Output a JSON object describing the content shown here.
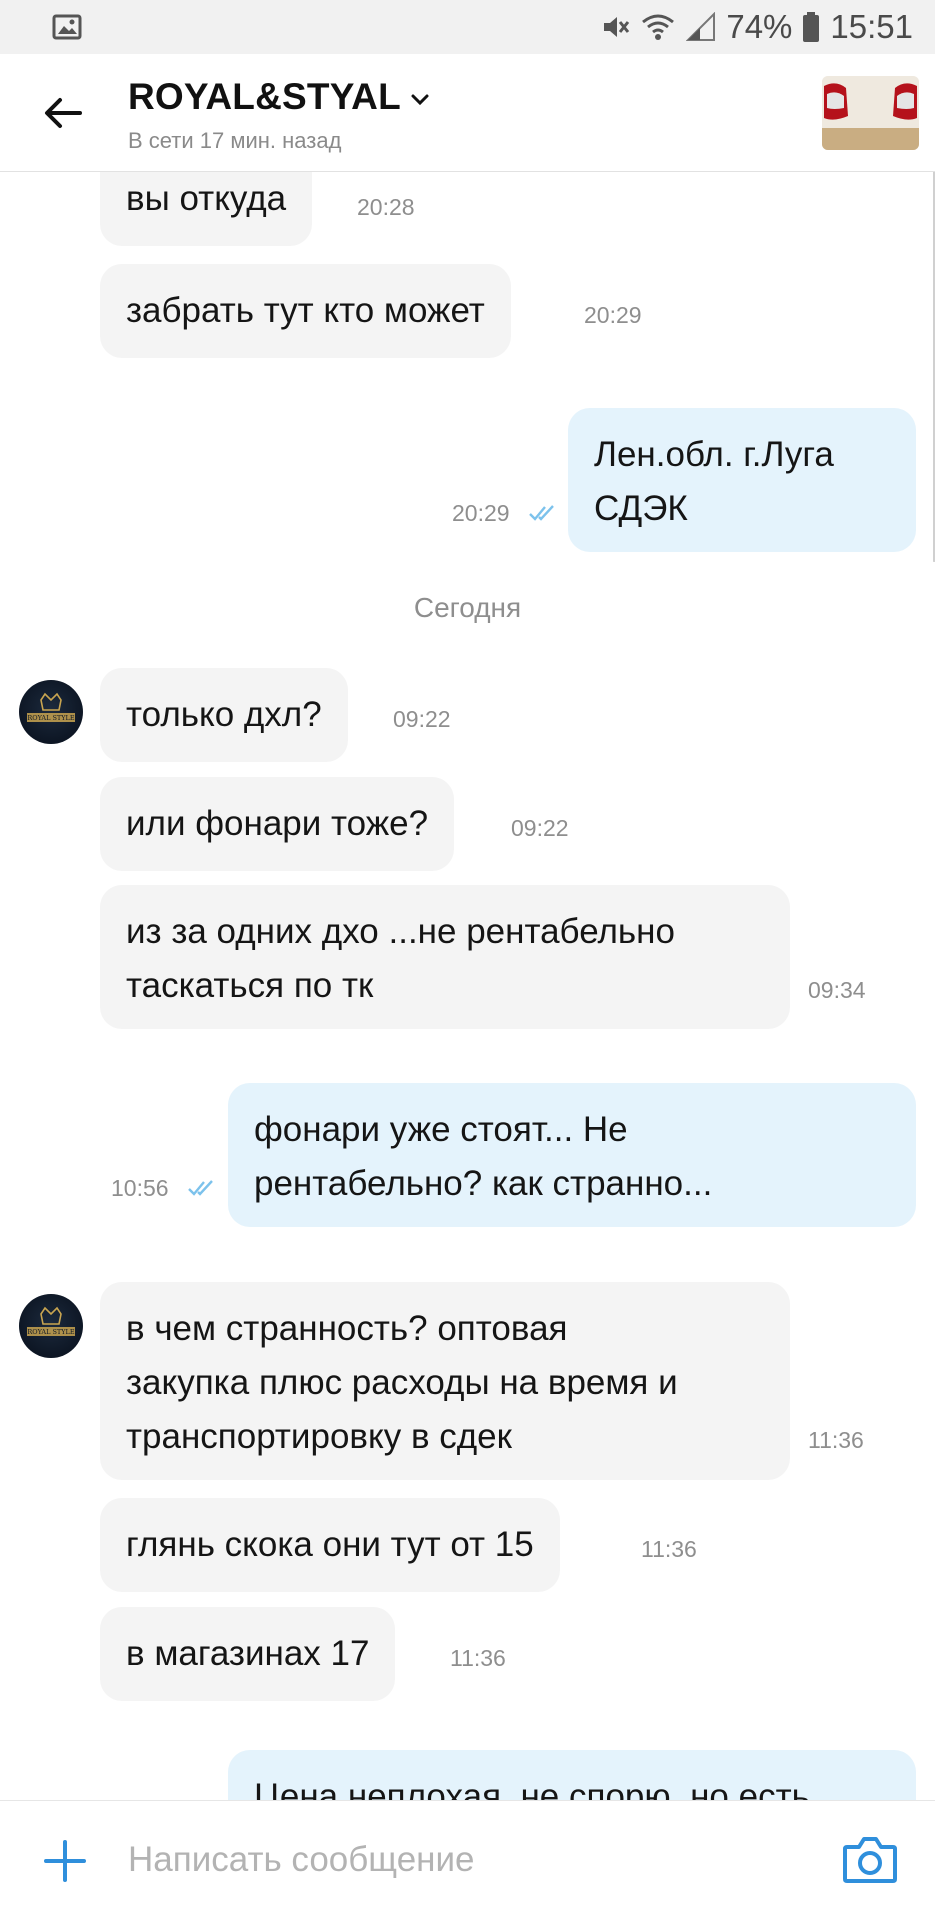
{
  "status_bar": {
    "battery": "74%",
    "time": "15:51",
    "icons": [
      "image-icon",
      "mute-icon",
      "wifi-icon",
      "signal-icon",
      "battery-icon"
    ]
  },
  "header": {
    "title": "ROYAL&STYAL",
    "subtitle": "В сети 17 мин. назад",
    "back_icon": "back-arrow-icon",
    "dropdown_icon": "chevron-down-icon"
  },
  "messages": [
    {
      "dir": "in",
      "text": "вы откуда",
      "time": "20:28"
    },
    {
      "dir": "in",
      "text": "забрать тут кто может",
      "time": "20:29"
    },
    {
      "dir": "out",
      "text_lines": [
        "Лен.обл. г.Луга",
        "СДЭК"
      ],
      "time": "20:29",
      "read": true
    },
    {
      "dir": "in",
      "text": "только дхл?",
      "time": "09:22"
    },
    {
      "dir": "in",
      "text": "или фонари тоже?",
      "time": "09:22"
    },
    {
      "dir": "in",
      "text_lines": [
        "из за одних дхо ...не рентабельно",
        "таскаться по тк"
      ],
      "time": "09:34"
    },
    {
      "dir": "out",
      "text_lines": [
        "фонари уже стоят... Не",
        "рентабельно? как странно..."
      ],
      "time": "10:56",
      "read": true
    },
    {
      "dir": "in",
      "text_lines": [
        "в чем странность? оптовая",
        "закупка плюс расходы на время и",
        "транспортировку в сдек"
      ],
      "time": "11:36"
    },
    {
      "dir": "in",
      "text": "глянь скока они тут от 15",
      "time": "11:36"
    },
    {
      "dir": "in",
      "text": "в магазинах 17",
      "time": "11:36"
    },
    {
      "dir": "out",
      "text": "Цена неплохая, не спорю, но есть"
    }
  ],
  "date_separator": "Сегодня",
  "avatar_label": "ROYAL STYLE",
  "composer": {
    "placeholder": "Написать сообщение",
    "plus_icon": "plus-icon",
    "camera_icon": "camera-icon"
  },
  "colors": {
    "accent": "#2f8fdc",
    "incoming_bubble": "#f4f4f4",
    "outgoing_bubble": "#e4f3fc",
    "read_checks": "#7cc2ec"
  }
}
